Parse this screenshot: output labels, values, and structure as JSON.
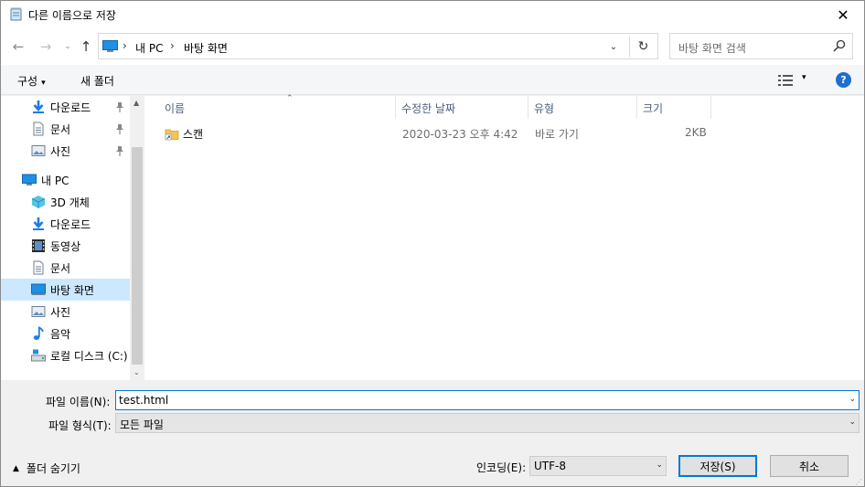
{
  "window": {
    "title": "다른 이름으로 저장",
    "close_glyph": "✕"
  },
  "nav": {
    "back_glyph": "←",
    "forward_glyph": "→",
    "recent_glyph": "⌄",
    "up_glyph": "↑",
    "breadcrumbs": [
      "내 PC",
      "바탕 화면"
    ],
    "separator": "›",
    "dropdown_glyph": "⌄",
    "refresh_glyph": "↻",
    "search_placeholder": "바탕 화면 검색"
  },
  "toolbar": {
    "organize_label": "구성",
    "organize_caret": "▾",
    "new_folder_label": "새 폴더",
    "view_caret": "▾",
    "help_label": "?"
  },
  "sidebar": {
    "scroll_up": "▲",
    "scroll_down": "⌄",
    "items": [
      {
        "label": "다운로드",
        "icon": "download-arrow-icon",
        "pinned": true
      },
      {
        "label": "문서",
        "icon": "document-icon",
        "pinned": true
      },
      {
        "label": "사진",
        "icon": "pictures-icon",
        "pinned": true
      },
      {
        "label": "내 PC",
        "icon": "computer-icon",
        "pinned": false
      },
      {
        "label": "3D 개체",
        "icon": "cube-3d-icon",
        "pinned": false
      },
      {
        "label": "다운로드",
        "icon": "download-arrow-icon",
        "pinned": false
      },
      {
        "label": "동영상",
        "icon": "video-film-icon",
        "pinned": false
      },
      {
        "label": "문서",
        "icon": "document-icon",
        "pinned": false
      },
      {
        "label": "바탕 화면",
        "icon": "desktop-icon",
        "pinned": false,
        "selected": true
      },
      {
        "label": "사진",
        "icon": "pictures-icon",
        "pinned": false
      },
      {
        "label": "음악",
        "icon": "music-note-icon",
        "pinned": false
      },
      {
        "label": "로컬 디스크 (C:)",
        "icon": "drive-icon",
        "pinned": false
      }
    ]
  },
  "filelist": {
    "columns": [
      "이름",
      "수정한 날짜",
      "유형",
      "크기"
    ],
    "sort_glyph": "⌃",
    "rows": [
      {
        "name": "스캔",
        "date": "2020-03-23 오후 4:42",
        "type": "바로 가기",
        "size": "2KB",
        "icon": "folder-shortcut-icon"
      }
    ]
  },
  "form": {
    "filename_label": "파일 이름(N):",
    "filename_value": "test.html",
    "filetype_label": "파일 형식(T):",
    "filetype_value": "모든 파일",
    "combo_caret": "⌄",
    "hide_folders_caret": "▲",
    "hide_folders_label": "폴더 숨기기",
    "encoding_label": "인코딩(E):",
    "encoding_value": "UTF-8",
    "save_label": "저장(S)",
    "cancel_label": "취소"
  },
  "colors": {
    "accent": "#0078d7",
    "selection": "#cce8ff",
    "header_text": "#4c607a",
    "help_blue": "#1d6fd0"
  }
}
